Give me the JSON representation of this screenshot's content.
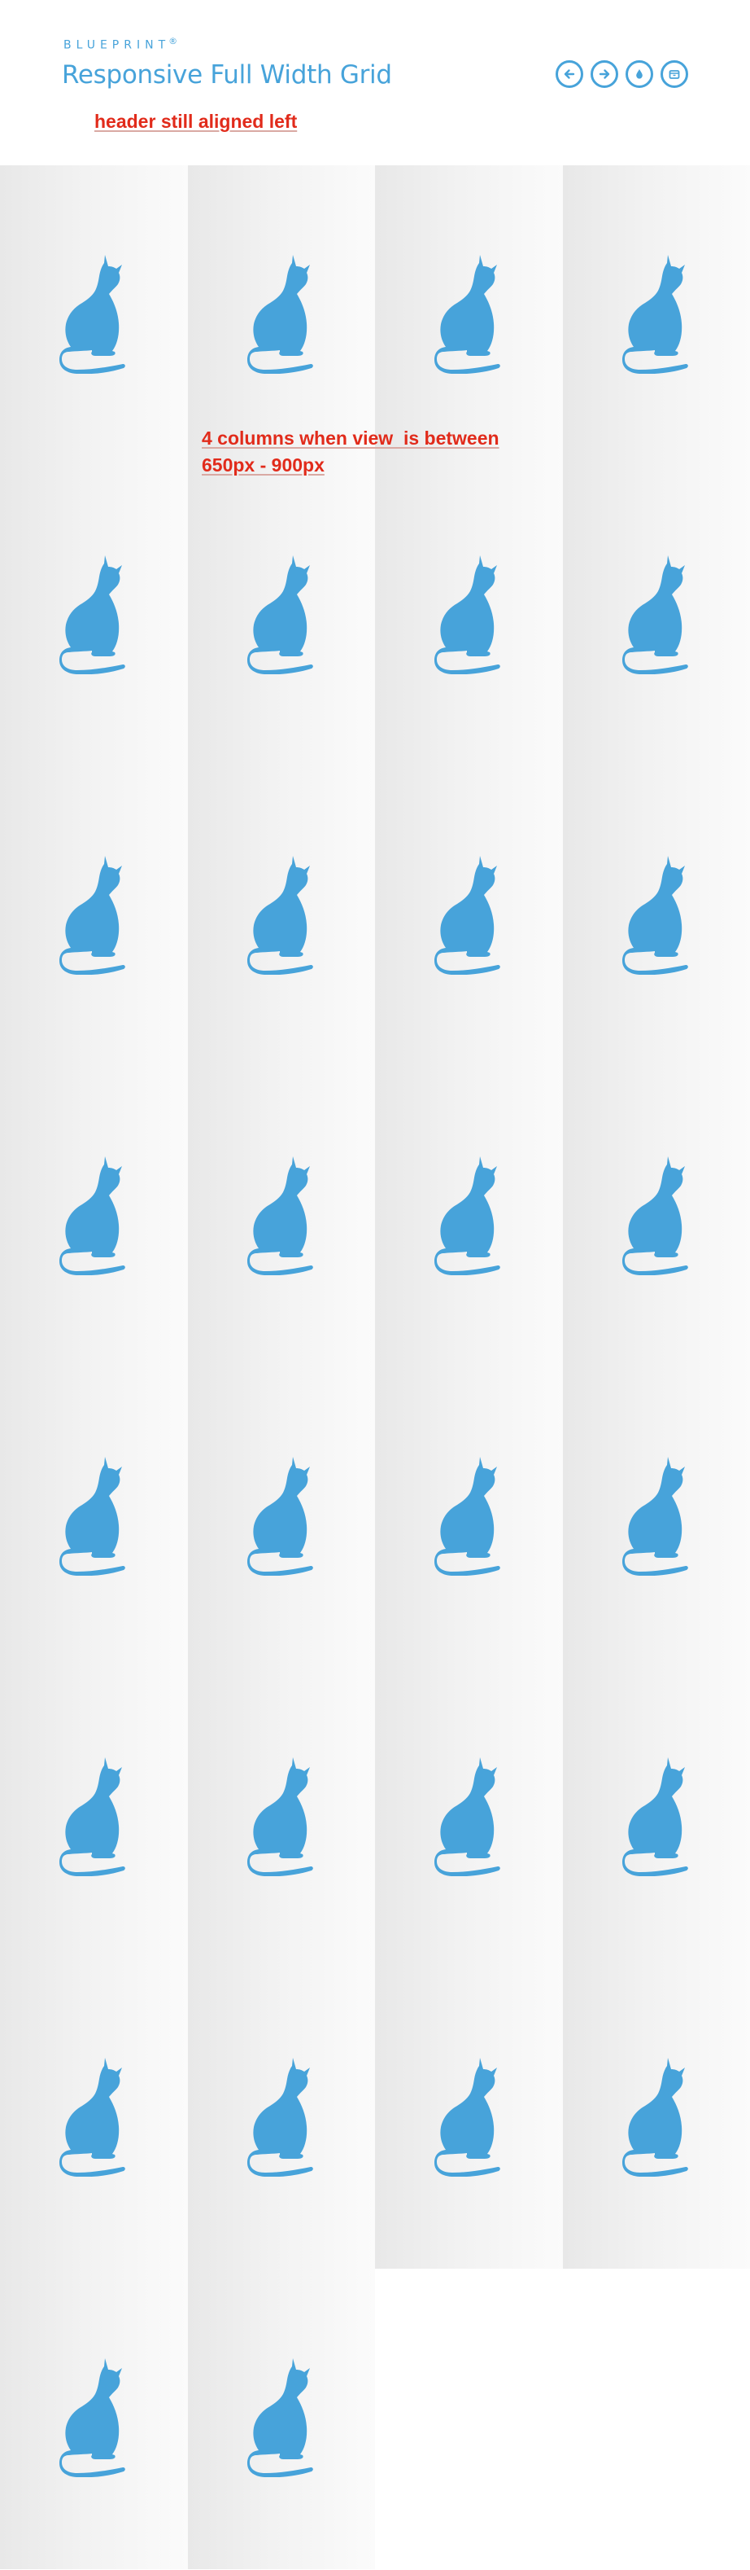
{
  "header": {
    "brand": "BLUEPRINT",
    "brand_mark": "®",
    "title": "Responsive Full Width Grid",
    "nav_buttons": [
      {
        "icon": "arrow-left-icon"
      },
      {
        "icon": "arrow-right-icon"
      },
      {
        "icon": "drop-icon"
      },
      {
        "icon": "archive-icon"
      }
    ]
  },
  "annotations": {
    "header_note": "header still aligned left",
    "columns_note_line1": "4 columns when view  is between",
    "columns_note_line2": "650px - 900px"
  },
  "grid": {
    "columns": 4,
    "item_count": 30,
    "item_icon": "cat-silhouette-icon"
  },
  "colors": {
    "accent": "#47a3da",
    "annotation": "#e12b1b"
  }
}
